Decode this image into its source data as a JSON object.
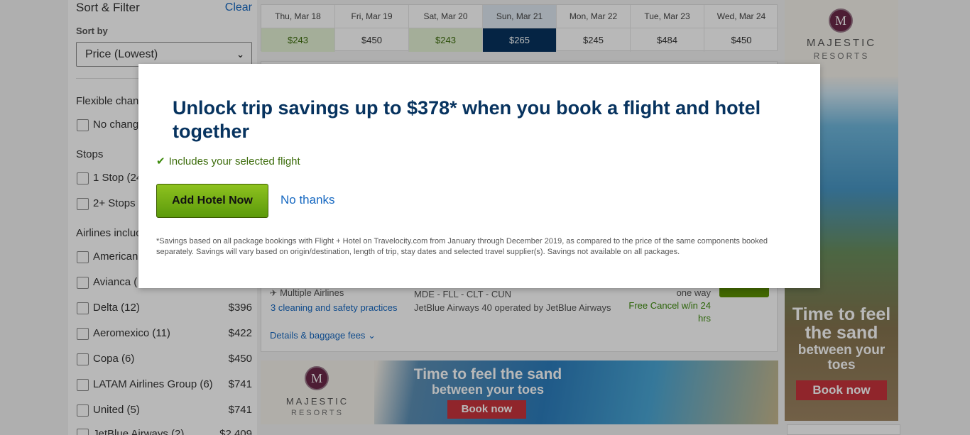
{
  "sidebar": {
    "title": "Sort & Filter",
    "clear_label": "Clear",
    "sort_label": "Sort by",
    "sort_value": "Price (Lowest)",
    "flexible_label": "Flexible chan",
    "no_change_label": "No chang",
    "stops_label": "Stops",
    "stops": [
      {
        "label": "1 Stop (24"
      },
      {
        "label": "2+ Stops"
      }
    ],
    "airlines_label": "Airlines incluc",
    "airlines": [
      {
        "label": "American",
        "price": ""
      },
      {
        "label": "Avianca (",
        "price": ""
      },
      {
        "label": "Delta (12)",
        "price": "$396"
      },
      {
        "label": "Aeromexico (11)",
        "price": "$422"
      },
      {
        "label": "Copa (6)",
        "price": "$450"
      },
      {
        "label": "LATAM Airlines Group (6)",
        "price": "$741"
      },
      {
        "label": "United (5)",
        "price": "$741"
      },
      {
        "label": "JetBlue Airways (2)",
        "price": "$2,409"
      }
    ]
  },
  "datebar": [
    {
      "date": "Thu, Mar 18",
      "price": "$243",
      "state": "cheap"
    },
    {
      "date": "Fri, Mar 19",
      "price": "$450",
      "state": "normal"
    },
    {
      "date": "Sat, Mar 20",
      "price": "$243",
      "state": "cheap"
    },
    {
      "date": "Sun, Mar 21",
      "price": "$265",
      "state": "selected"
    },
    {
      "date": "Mon, Mar 22",
      "price": "$245",
      "state": "normal"
    },
    {
      "date": "Tue, Mar 23",
      "price": "$484",
      "state": "normal"
    },
    {
      "date": "Wed, Mar 24",
      "price": "$450",
      "state": "normal"
    }
  ],
  "result": {
    "airline": "Multiple Airlines",
    "cleaning_link": "3 cleaning and safety practices",
    "route": "MDE - FLL - CLT - CUN",
    "operated_by": "JetBlue Airways 40 operated by JetBlue Airways",
    "one_way": "one way",
    "free_cancel": "Free Cancel w/in 24 hrs",
    "details_link": "Details & baggage fees"
  },
  "ad_banner": {
    "brand": "MAJESTIC",
    "brand_sub": "RESORTS",
    "headline": "Time to feel the sand",
    "subline": "between your toes",
    "cta": "Book now"
  },
  "ad_side": {
    "brand": "MAJESTIC",
    "brand_sub": "RESORTS",
    "headline": "Time to feel the sand",
    "subline": "between your toes",
    "cta": "Book now"
  },
  "modal": {
    "title": "Unlock trip savings up to $378* when you book a flight and hotel together",
    "includes": "Includes your selected flight",
    "add_hotel_label": "Add Hotel Now",
    "no_thanks_label": "No thanks",
    "fine_print": "*Savings based on all package bookings with Flight + Hotel on Travelocity.com from January through December 2019, as compared to the price of the same components booked separately. Savings will vary based on origin/destination, length of trip, stay dates and selected travel supplier(s). Savings not available on all packages."
  },
  "colors": {
    "brand_navy": "#07335f",
    "link_blue": "#1668c1",
    "cta_green": "#5c9a0b",
    "ad_red": "#c8343c"
  }
}
